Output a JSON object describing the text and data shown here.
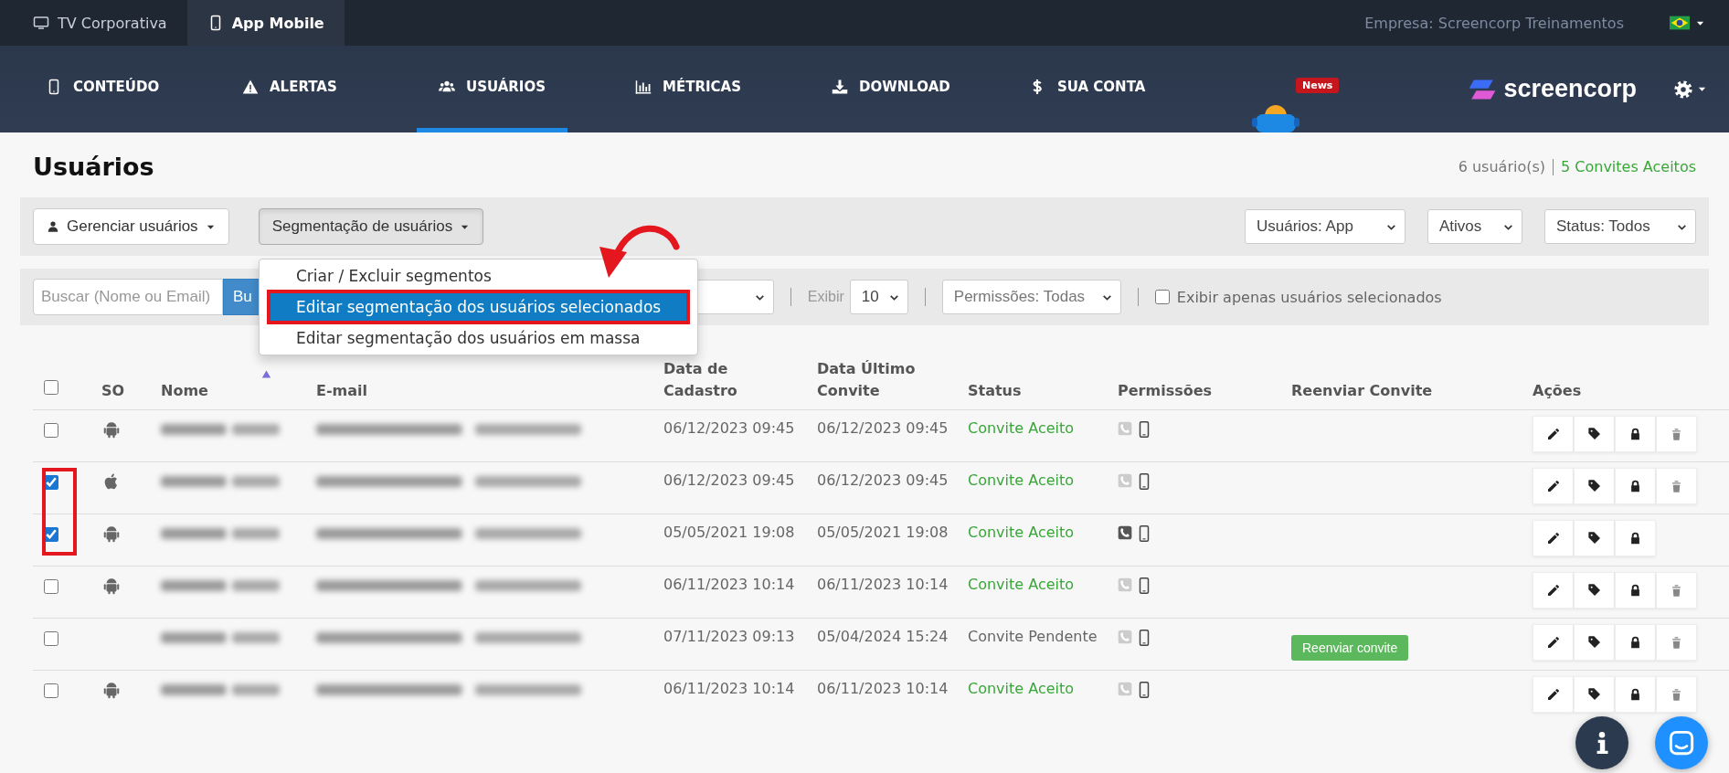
{
  "top_tabs": [
    {
      "label": "TV Corporativa",
      "kind": "monitor",
      "selected": false
    },
    {
      "label": "App Mobile",
      "kind": "mobile",
      "selected": true
    }
  ],
  "company": "Empresa: Screencorp Treinamentos",
  "nav": [
    {
      "label": "CONTEÚDO",
      "kind": "mobile",
      "selected": false
    },
    {
      "label": "ALERTAS",
      "kind": "warning",
      "selected": false
    },
    {
      "label": "USUÁRIOS",
      "kind": "users",
      "selected": true
    },
    {
      "label": "MÉTRICAS",
      "kind": "chart",
      "selected": false
    },
    {
      "label": "DOWNLOAD",
      "kind": "download",
      "selected": false
    },
    {
      "label": "SUA CONTA",
      "kind": "dollar",
      "selected": false
    }
  ],
  "news_badge": "News",
  "logo": "screencorp",
  "page_title": "Usuários",
  "summary": {
    "count": "6 usuário(s)",
    "accepted": "5 Convites Aceitos"
  },
  "toolbar": {
    "manage_button": "Gerenciar usuários",
    "segment_button": "Segmentação de usuários",
    "filters": [
      "Usuários: App",
      "Ativos",
      "Status: Todos"
    ]
  },
  "segment_menu": [
    {
      "label": "Criar / Excluir segmentos",
      "selected": false
    },
    {
      "label": "Editar segmentação dos usuários selecionados",
      "selected": true
    },
    {
      "label": "Editar segmentação dos usuários em massa",
      "selected": false
    }
  ],
  "filter_bar": {
    "search_placeholder": "Buscar (Nome ou Email)",
    "search_button": "Bu",
    "show_label": "Exibir",
    "page_size": "10",
    "permissions_filter": "Permissões: Todas",
    "only_selected": {
      "label": "Exibir apenas usuários selecionados",
      "checked": false
    }
  },
  "table": {
    "select_all_checked": false,
    "columns": [
      "SO",
      "Nome",
      "E-mail",
      "Data de\nCadastro",
      "Data Último\nConvite",
      "Status",
      "Permissões",
      "Reenviar Convite",
      "Ações"
    ],
    "rows": [
      {
        "checked": false,
        "kind": "android",
        "registered": "06/12/2023 09:45",
        "last_invite": "06/12/2023 09:45",
        "status": "Convite Aceito",
        "pending": false,
        "phone_permission": false,
        "can_delete": true
      },
      {
        "checked": true,
        "kind": "apple",
        "registered": "06/12/2023 09:45",
        "last_invite": "06/12/2023 09:45",
        "status": "Convite Aceito",
        "pending": false,
        "phone_permission": false,
        "can_delete": true
      },
      {
        "checked": true,
        "kind": "android",
        "registered": "05/05/2021 19:08",
        "last_invite": "05/05/2021 19:08",
        "status": "Convite Aceito",
        "pending": false,
        "phone_permission": true,
        "can_delete": false
      },
      {
        "checked": false,
        "kind": "android",
        "registered": "06/11/2023 10:14",
        "last_invite": "06/11/2023 10:14",
        "status": "Convite Aceito",
        "pending": false,
        "phone_permission": false,
        "can_delete": true
      },
      {
        "checked": false,
        "kind": "unknown",
        "registered": "07/11/2023 09:13",
        "last_invite": "05/04/2024 15:24",
        "status": "Convite Pendente",
        "pending": true,
        "resend_button": "Reenviar convite",
        "phone_permission": false,
        "can_delete": true
      },
      {
        "checked": false,
        "kind": "android",
        "registered": "06/11/2023 10:14",
        "last_invite": "06/11/2023 10:14",
        "status": "Convite Aceito",
        "pending": false,
        "phone_permission": false,
        "can_delete": true
      }
    ]
  }
}
